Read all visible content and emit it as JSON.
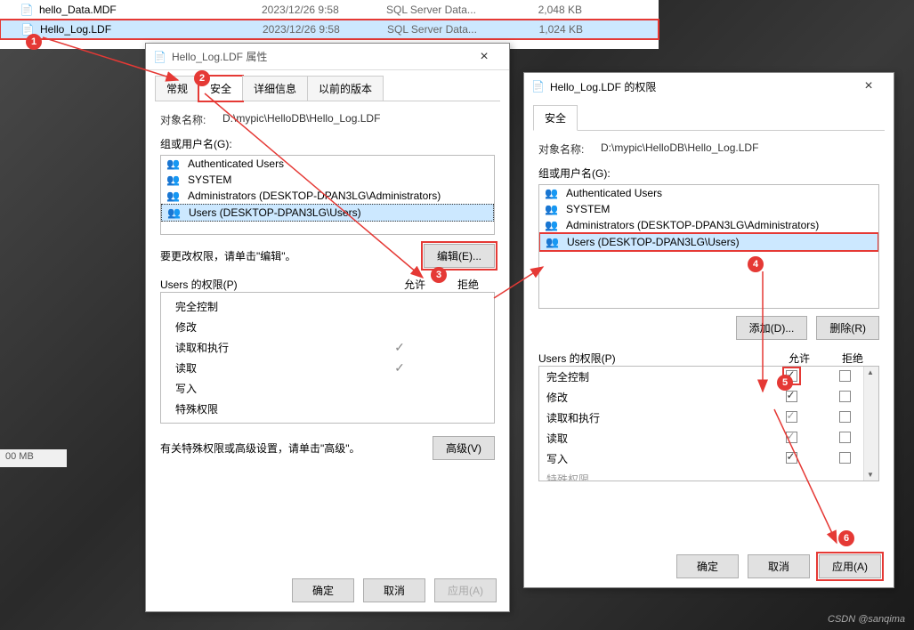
{
  "explorer": {
    "files": [
      {
        "name": "hello_Data.MDF",
        "date": "2023/12/26 9:58",
        "type": "SQL Server Data...",
        "size": "2,048 KB"
      },
      {
        "name": "Hello_Log.LDF",
        "date": "2023/12/26 9:58",
        "type": "SQL Server Data...",
        "size": "1,024 KB"
      }
    ],
    "status": "00 MB"
  },
  "dlg1": {
    "title": "Hello_Log.LDF 属性",
    "tabs": [
      "常规",
      "安全",
      "详细信息",
      "以前的版本"
    ],
    "objectLabel": "对象名称:",
    "objectPath": "D:\\mypic\\HelloDB\\Hello_Log.LDF",
    "groupLabel": "组或用户名(G):",
    "groups": [
      "Authenticated Users",
      "SYSTEM",
      "Administrators (DESKTOP-DPAN3LG\\Administrators)",
      "Users (DESKTOP-DPAN3LG\\Users)"
    ],
    "editHint": "要更改权限，请单击\"编辑\"。",
    "editBtn": "编辑(E)...",
    "permLabel": "Users 的权限(P)",
    "allow": "允许",
    "deny": "拒绝",
    "perms": [
      "完全控制",
      "修改",
      "读取和执行",
      "读取",
      "写入",
      "特殊权限"
    ],
    "advHint": "有关特殊权限或高级设置，请单击\"高级\"。",
    "advBtn": "高级(V)",
    "ok": "确定",
    "cancel": "取消",
    "apply": "应用(A)"
  },
  "dlg2": {
    "title": "Hello_Log.LDF 的权限",
    "tab": "安全",
    "objectLabel": "对象名称:",
    "objectPath": "D:\\mypic\\HelloDB\\Hello_Log.LDF",
    "groupLabel": "组或用户名(G):",
    "groups": [
      "Authenticated Users",
      "SYSTEM",
      "Administrators (DESKTOP-DPAN3LG\\Administrators)",
      "Users (DESKTOP-DPAN3LG\\Users)"
    ],
    "addBtn": "添加(D)...",
    "delBtn": "删除(R)",
    "permLabel": "Users 的权限(P)",
    "allow": "允许",
    "deny": "拒绝",
    "perms": [
      {
        "name": "完全控制",
        "allow": true,
        "deny": false
      },
      {
        "name": "修改",
        "allow": true,
        "deny": false
      },
      {
        "name": "读取和执行",
        "allow": true,
        "gray": true,
        "deny": false
      },
      {
        "name": "读取",
        "allow": true,
        "gray": true,
        "deny": false
      },
      {
        "name": "写入",
        "allow": true,
        "deny": false
      },
      {
        "name": "特殊权限",
        "allow": false,
        "deny": false,
        "partial": true
      }
    ],
    "ok": "确定",
    "cancel": "取消",
    "apply": "应用(A)"
  },
  "watermark": "CSDN @sanqima"
}
